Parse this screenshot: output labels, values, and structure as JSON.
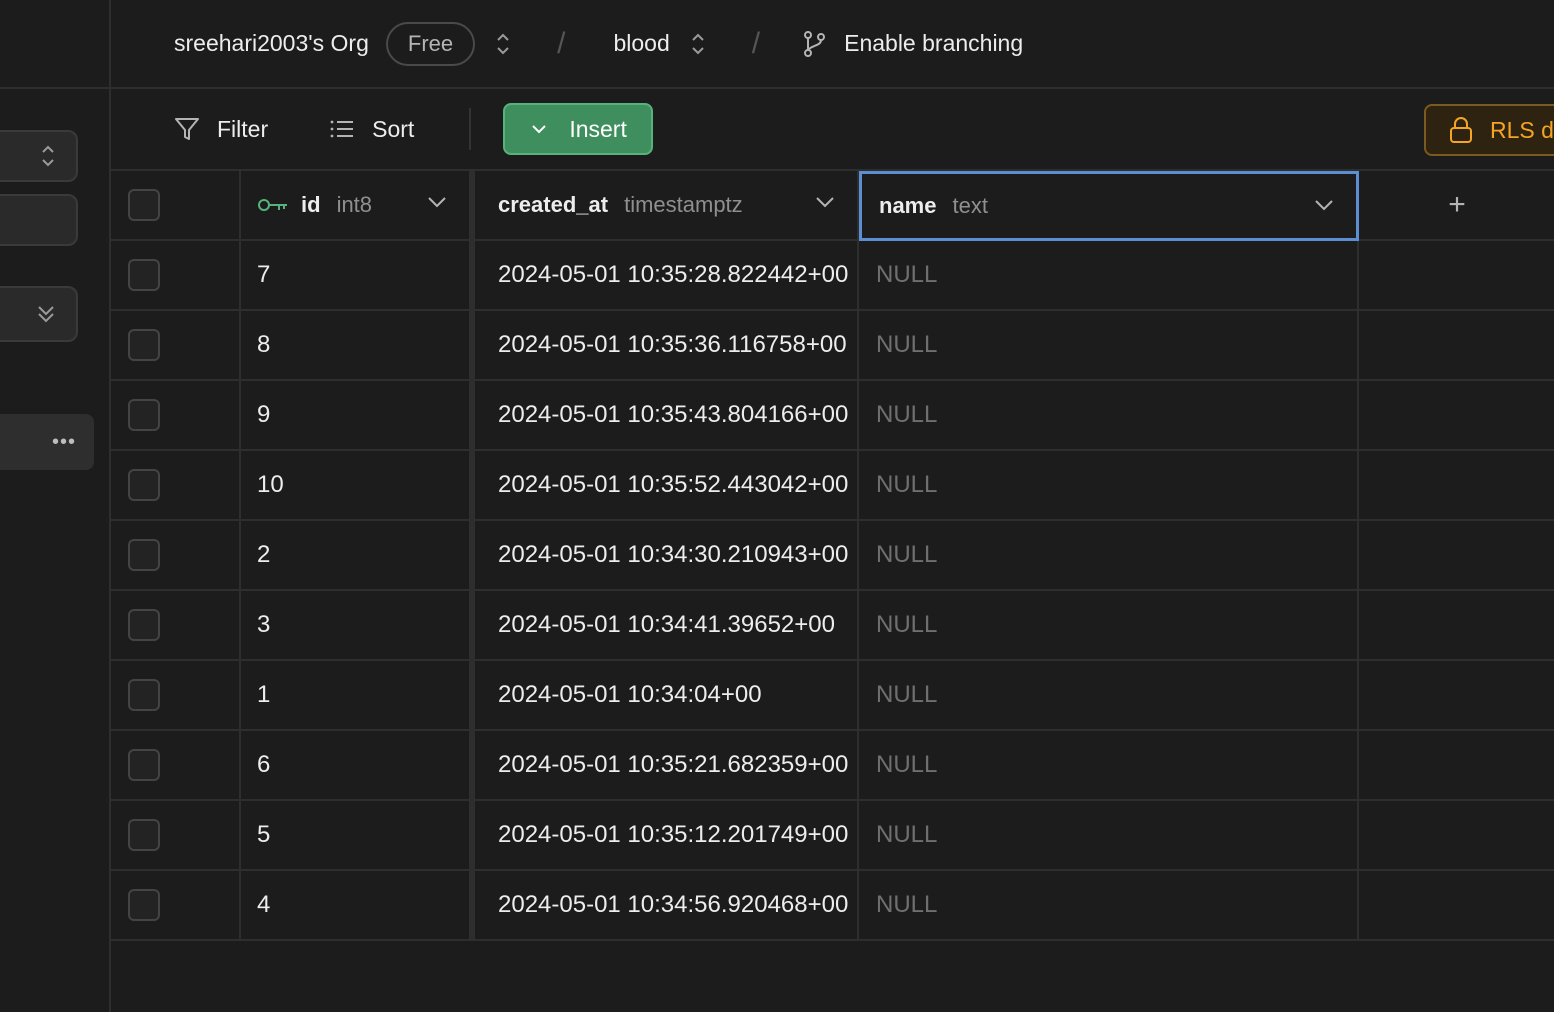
{
  "header": {
    "org_name": "sreehari2003's Org",
    "plan_badge": "Free",
    "project_name": "blood",
    "branching_label": "Enable branching"
  },
  "toolbar": {
    "filter_label": "Filter",
    "sort_label": "Sort",
    "insert_label": "Insert",
    "rls_label": "RLS d"
  },
  "sidebar": {
    "active_item_more": "•••"
  },
  "table": {
    "columns": [
      {
        "name": "id",
        "type": "int8",
        "primary_key": true
      },
      {
        "name": "created_at",
        "type": "timestamptz"
      },
      {
        "name": "name",
        "type": "text"
      }
    ],
    "add_column_label": "+",
    "rows": [
      {
        "id": "7",
        "created_at": "2024-05-01 10:35:28.822442+00",
        "name": "NULL"
      },
      {
        "id": "8",
        "created_at": "2024-05-01 10:35:36.116758+00",
        "name": "NULL"
      },
      {
        "id": "9",
        "created_at": "2024-05-01 10:35:43.804166+00",
        "name": "NULL"
      },
      {
        "id": "10",
        "created_at": "2024-05-01 10:35:52.443042+00",
        "name": "NULL"
      },
      {
        "id": "2",
        "created_at": "2024-05-01 10:34:30.210943+00",
        "name": "NULL"
      },
      {
        "id": "3",
        "created_at": "2024-05-01 10:34:41.39652+00",
        "name": "NULL"
      },
      {
        "id": "1",
        "created_at": "2024-05-01 10:34:04+00",
        "name": "NULL"
      },
      {
        "id": "6",
        "created_at": "2024-05-01 10:35:21.682359+00",
        "name": "NULL"
      },
      {
        "id": "5",
        "created_at": "2024-05-01 10:35:12.201749+00",
        "name": "NULL"
      },
      {
        "id": "4",
        "created_at": "2024-05-01 10:34:56.920468+00",
        "name": "NULL"
      }
    ]
  },
  "colors": {
    "accent_green": "#3f8f5e",
    "rls_amber": "#f5a524",
    "selection_blue": "#5b8fd1"
  }
}
